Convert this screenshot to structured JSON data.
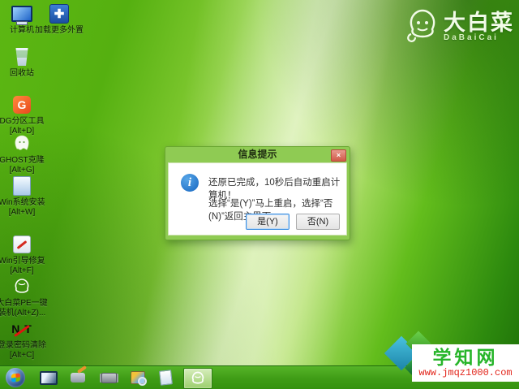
{
  "desktop": {
    "icons": [
      {
        "name": "computer",
        "label": "计算机"
      },
      {
        "name": "load-more-ext",
        "label": "加载更多外置"
      },
      {
        "name": "recycle-bin",
        "label": "回收站"
      },
      {
        "name": "dg-partition",
        "label": "DG分区工具",
        "label2": "[Alt+D]"
      },
      {
        "name": "ghost-clone",
        "label": "GHOST克隆",
        "label2": "[Alt+G]"
      },
      {
        "name": "win-install",
        "label": "Win系统安装",
        "label2": "[Alt+W]"
      },
      {
        "name": "win-boot-repair",
        "label": "Win引导修复",
        "label2": "[Alt+F]"
      },
      {
        "name": "dabaicai-pe",
        "label": "大白菜PE一键",
        "label2": "装机(Alt+Z)..."
      },
      {
        "name": "nt-password",
        "label": "登录密码清除",
        "label2": "[Alt+C]"
      }
    ]
  },
  "logo": {
    "title": "大白菜",
    "subtitle": "DaBaiCai"
  },
  "dialog": {
    "title": "信息提示",
    "close_label": "×",
    "message_line1": "还原已完成，10秒后自动重启计算机！",
    "message_line2": "选择“是(Y)”马上重启，选择“否(N)”返回主界面。",
    "yes_label": "是(Y)",
    "no_label": "否(N)"
  },
  "taskbar": {
    "icons": [
      "start-orb",
      "computer",
      "disk-tool",
      "memory-chip",
      "partition-tool",
      "notepad",
      "dabaicai-active"
    ]
  },
  "watermark": {
    "title": "学知网",
    "url": "www.jmqz1000.com"
  },
  "colors": {
    "desktop_green": "#55b010",
    "dialog_frame": "#8fcb53",
    "close_red": "#d05a48",
    "info_blue": "#1565c0",
    "focus_blue": "#3d8fe0",
    "taskbar_green": "#3f9c16",
    "watermark_green": "#27b52a",
    "watermark_red": "#e2251b"
  }
}
